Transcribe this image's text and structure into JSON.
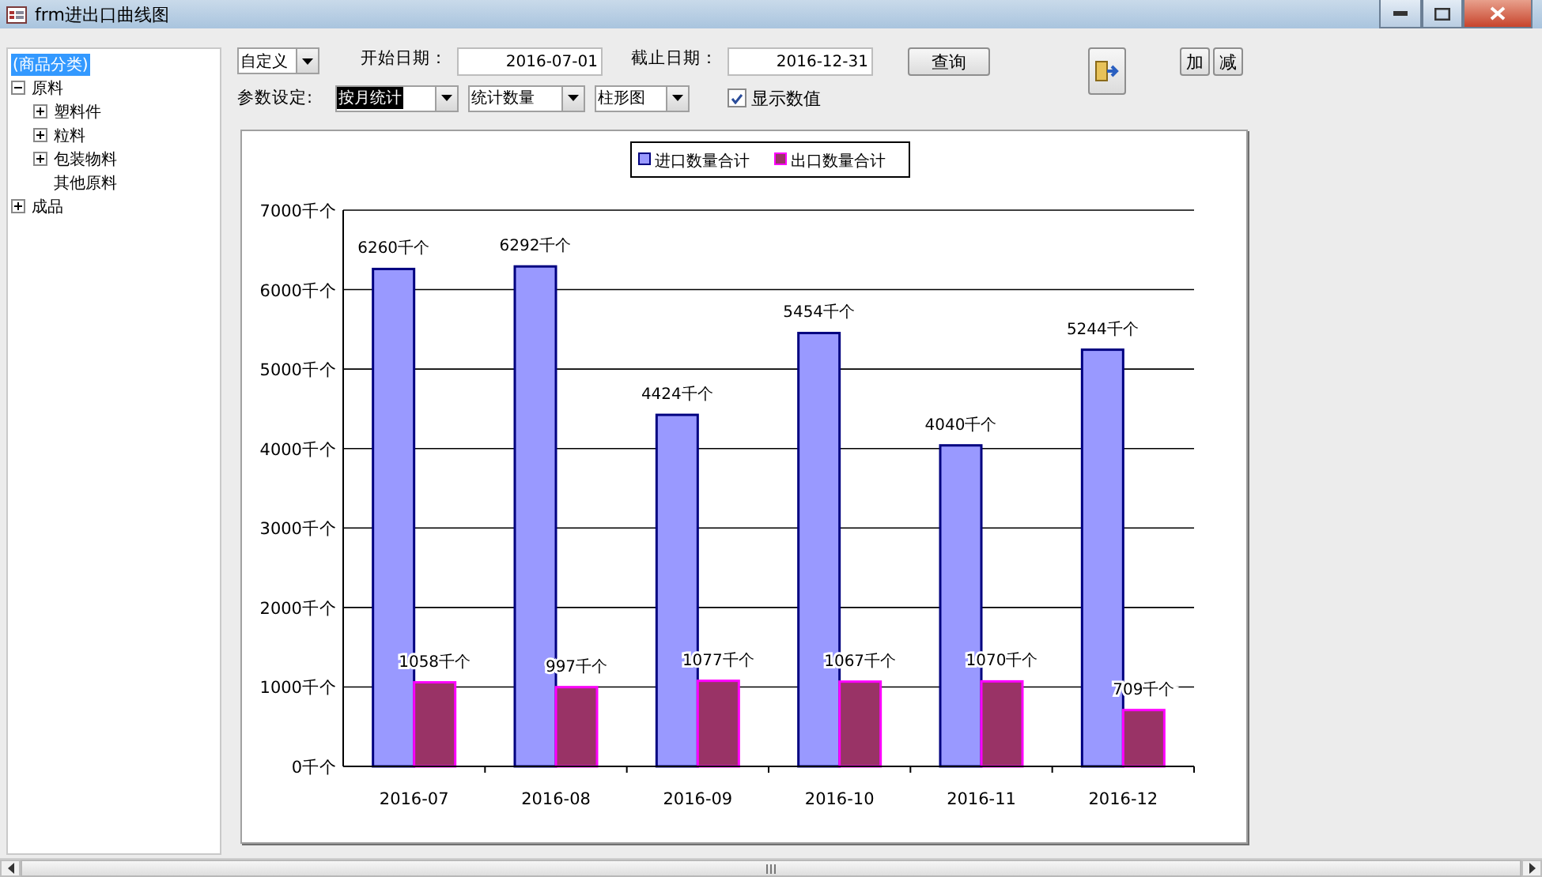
{
  "window": {
    "title": "frm进出口曲线图"
  },
  "tree": {
    "label": "(商品分类)",
    "selected": true,
    "children": [
      {
        "label": "原料",
        "expanded": true,
        "selected": false,
        "children": [
          {
            "label": "塑料件",
            "expanded": false,
            "selected": false
          },
          {
            "label": "粒料",
            "expanded": false,
            "selected": false
          },
          {
            "label": "包装物料",
            "expanded": false,
            "selected": false
          },
          {
            "label": "其他原料",
            "selected": false
          }
        ]
      },
      {
        "label": "成品",
        "expanded": false,
        "selected": false
      }
    ]
  },
  "toolbar": {
    "range_combo": {
      "value": "自定义",
      "highlighted": false
    },
    "start_label": "开始日期：",
    "start_date": "2016-07-01",
    "end_label": "截止日期：",
    "end_date": "2016-12-31",
    "query_button": "查询",
    "add_button": "加",
    "remove_button": "减",
    "params_label": "参数设定:",
    "combos": [
      {
        "value": "按月统计",
        "highlighted": true
      },
      {
        "value": "统计数量",
        "highlighted": false
      },
      {
        "value": "柱形图",
        "highlighted": false
      }
    ],
    "show_values": {
      "label": "显示数值",
      "checked": true
    }
  },
  "chart": {
    "chart_data": {
      "type": "bar",
      "categories": [
        "2016-07",
        "2016-08",
        "2016-09",
        "2016-10",
        "2016-11",
        "2016-12"
      ],
      "series": [
        {
          "name": "进口数量合计",
          "color": "#9999ff",
          "values": [
            6260,
            6292,
            4424,
            5454,
            4040,
            5244
          ]
        },
        {
          "name": "出口数量合计",
          "color": "#993366",
          "values": [
            1058,
            997,
            1077,
            1067,
            1070,
            709
          ]
        }
      ],
      "ylim": [
        0,
        7000
      ],
      "grid": true,
      "legend": true,
      "yticks": [
        {
          "value": 0,
          "label": "0千个"
        },
        {
          "value": 1000,
          "label": "1000千个"
        },
        {
          "value": 2000,
          "label": "2000千个"
        },
        {
          "value": 3000,
          "label": "3000千个"
        },
        {
          "value": 4000,
          "label": "4000千个"
        },
        {
          "value": 5000,
          "label": "5000千个"
        },
        {
          "value": 6000,
          "label": "6000千个"
        },
        {
          "value": 7000,
          "label": "7000千个"
        }
      ],
      "value_labels": [
        [
          "6260千个",
          "6292千个",
          "4424千个",
          "5454千个",
          "4040千个",
          "5244千个"
        ],
        [
          "1058千个",
          "997千个",
          "1077千个",
          "1067千个",
          "1070千个",
          "709千个"
        ]
      ]
    }
  }
}
